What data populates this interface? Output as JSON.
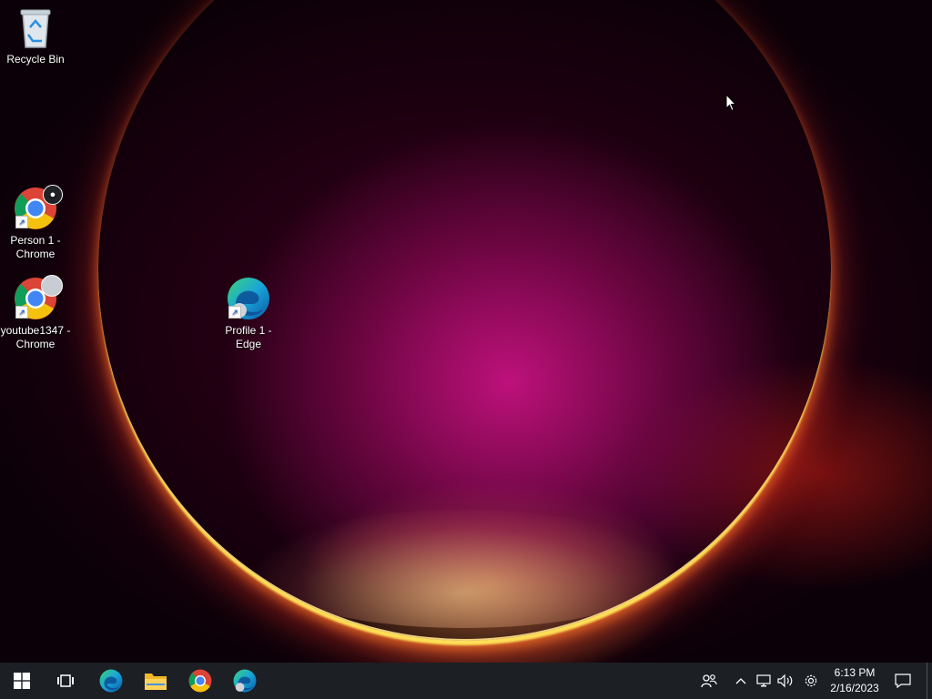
{
  "desktop": {
    "icons": [
      {
        "label": "Recycle Bin",
        "icon": "recycle-bin-icon"
      },
      {
        "label": "Person 1 - Chrome",
        "icon": "chrome-icon"
      },
      {
        "label": "youtube1347 - Chrome",
        "icon": "chrome-icon"
      },
      {
        "label": "Profile 1 - Edge",
        "icon": "edge-icon"
      }
    ]
  },
  "taskbar": {
    "pinned": [
      {
        "name": "Start",
        "icon": "windows-start-icon"
      },
      {
        "name": "Task View",
        "icon": "task-view-icon"
      },
      {
        "name": "Microsoft Edge",
        "icon": "edge-icon"
      },
      {
        "name": "File Explorer",
        "icon": "folder-icon"
      },
      {
        "name": "Google Chrome",
        "icon": "chrome-icon"
      },
      {
        "name": "Microsoft Edge Profile",
        "icon": "edge-icon"
      }
    ],
    "tray": {
      "icons": [
        "people-icon",
        "chevron-up-icon",
        "network-icon",
        "volume-icon",
        "settings-icon",
        "notification-icon"
      ],
      "time": "6:13 PM",
      "date": "2/16/2023"
    },
    "background": "#1c1f24"
  },
  "colors": {
    "wallpaper_accent": "#d6148c",
    "ring_glow": "#ffd060"
  }
}
